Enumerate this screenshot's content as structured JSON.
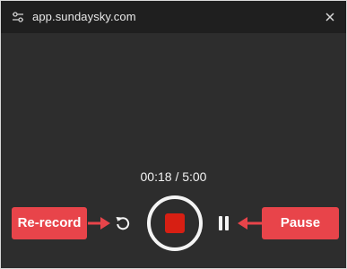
{
  "window": {
    "url": "app.sundaysky.com",
    "site_icon": "sliders-icon",
    "close_icon": "close-icon"
  },
  "recorder": {
    "timer": "00:18 / 5:00",
    "rerecord_icon": "rotate-ccw-icon",
    "stop_icon": "stop-icon",
    "pause_icon": "pause-icon"
  },
  "annotations": {
    "rerecord_label": "Re-record",
    "pause_label": "Pause",
    "color": "#e8444a"
  },
  "colors": {
    "background": "#2d2d2d",
    "titlebar": "#1f1f1f",
    "stop": "#d71f13"
  }
}
